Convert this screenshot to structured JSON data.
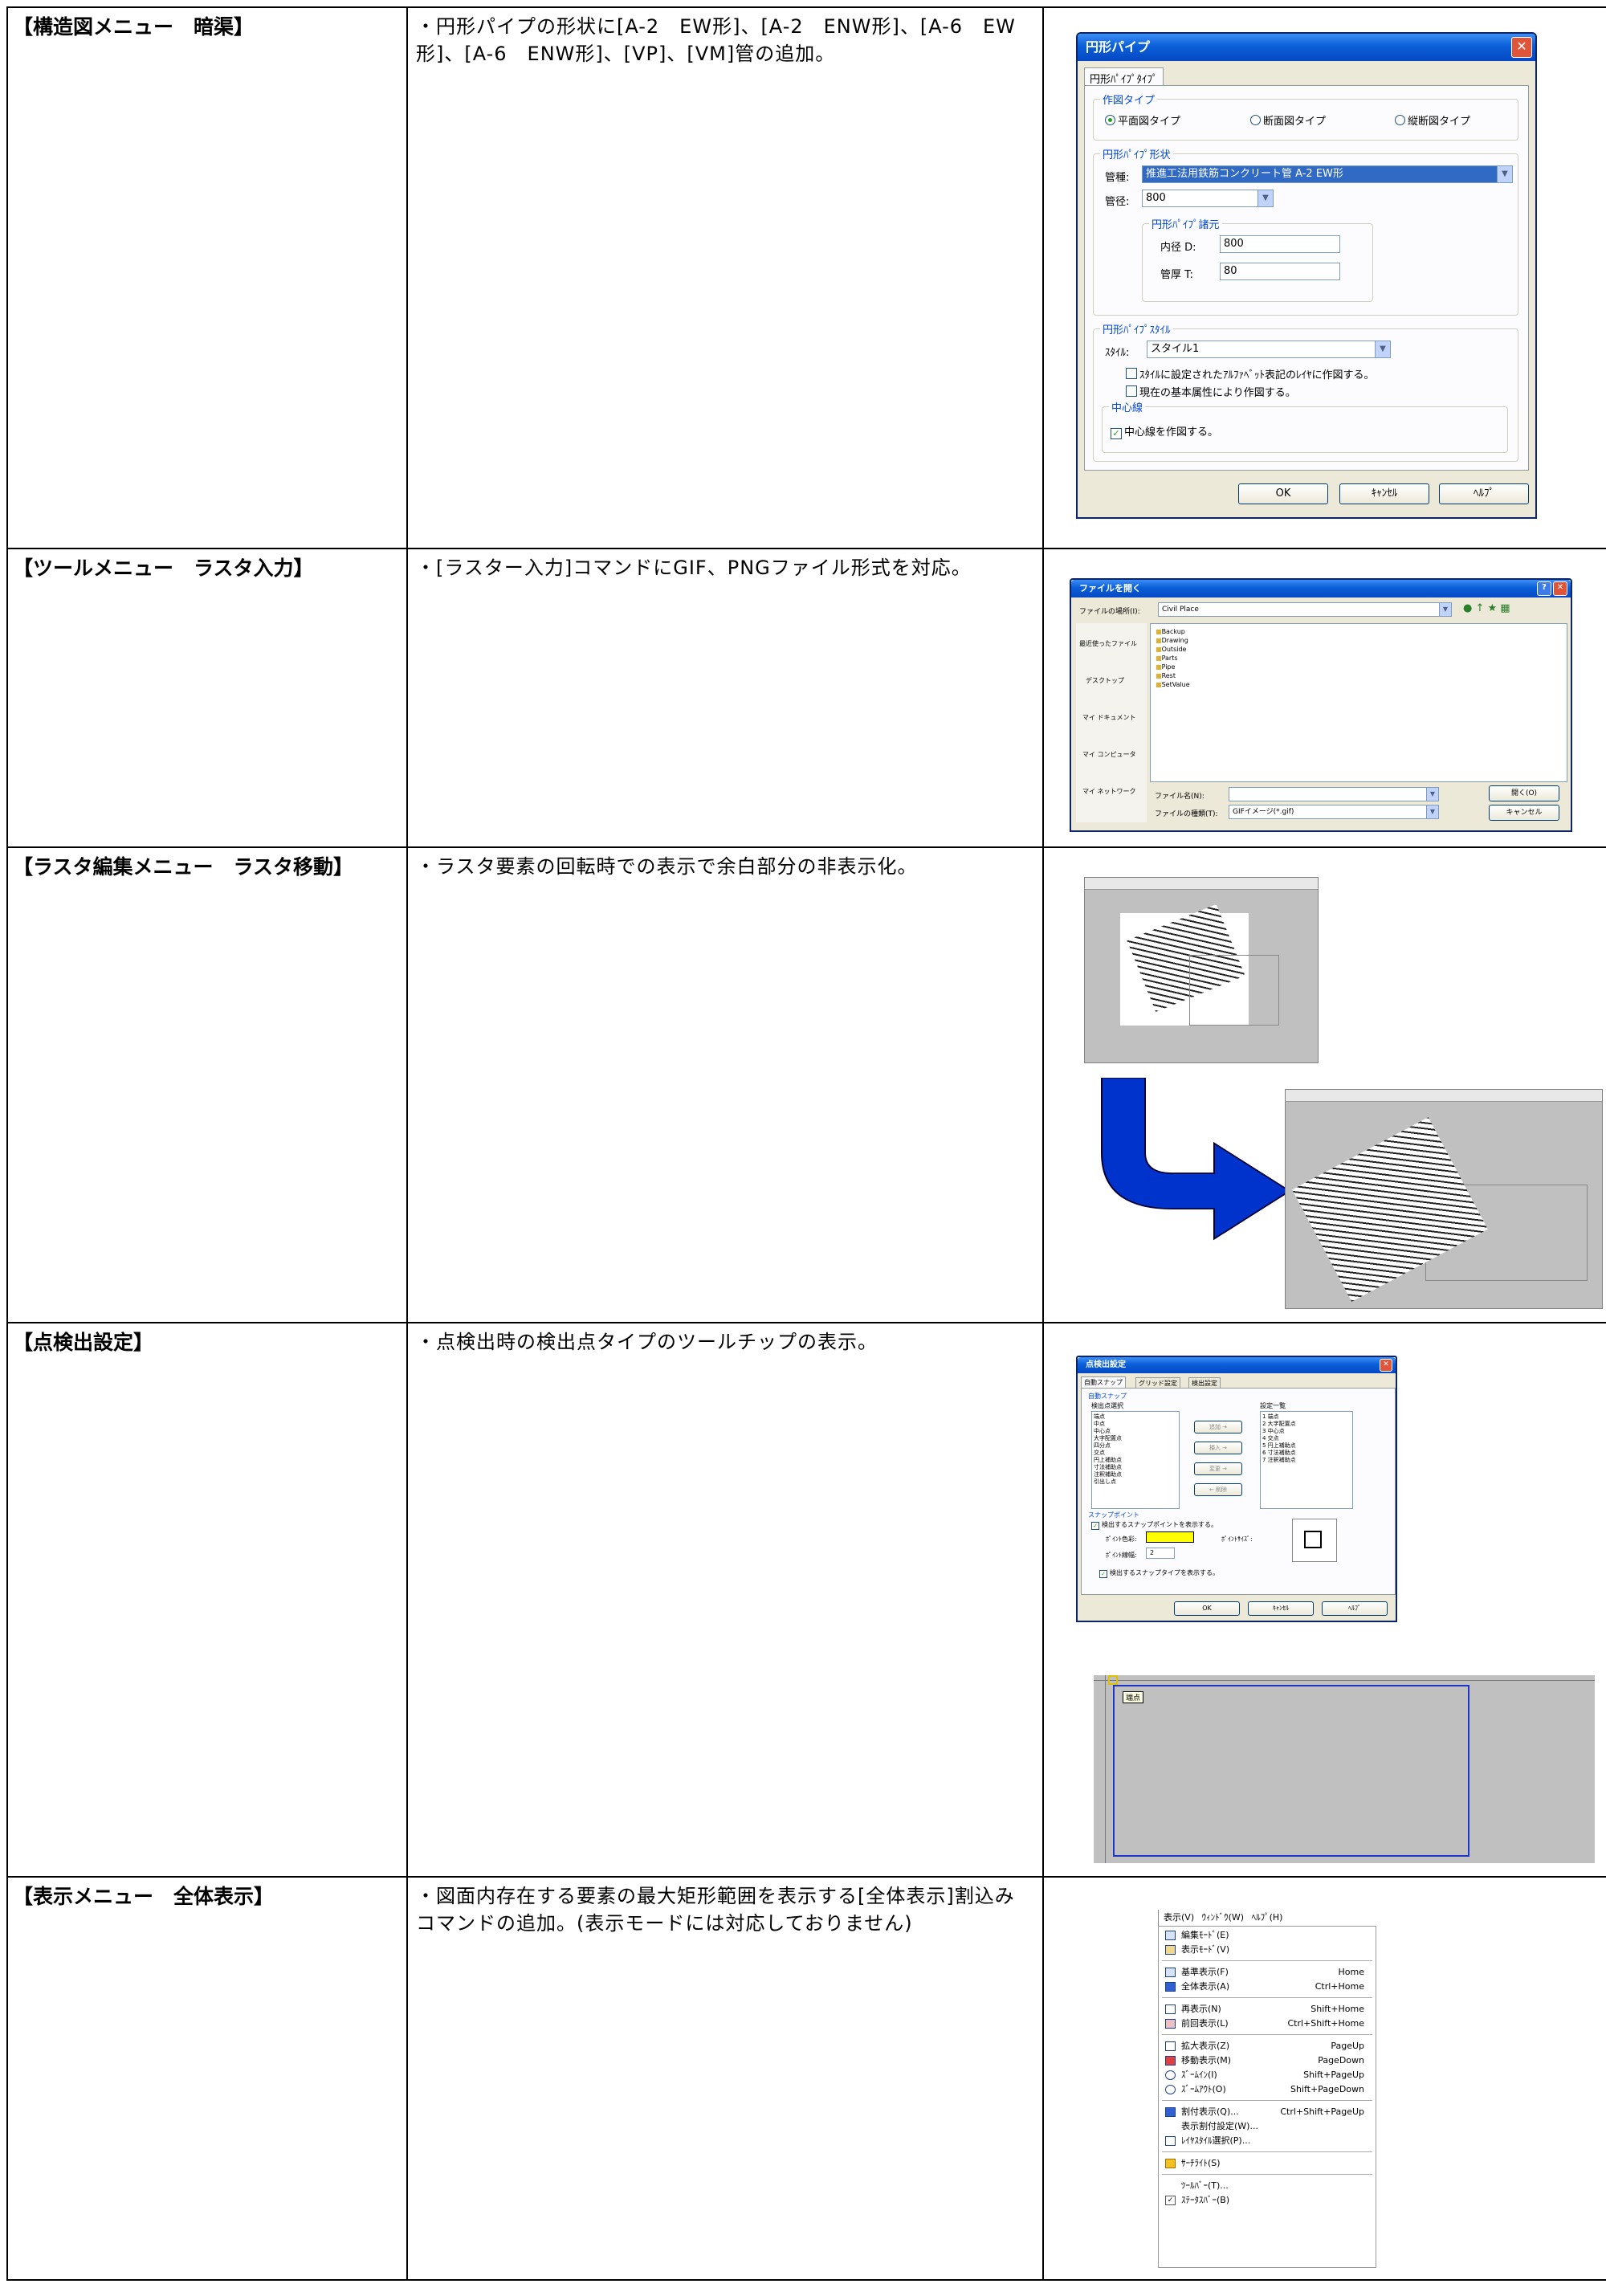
{
  "rows": [
    {
      "title": "【構造図メニュー　暗渠】",
      "desc": "・円形パイプの形状に[A-2　EW形]、[A-2　ENW形]、[A-6　EW形]、[A-6　ENW形]、[VP]、[VM]管の追加。"
    },
    {
      "title": "【ツールメニュー　ラスタ入力】",
      "desc": "・[ラスター入力]コマンドにGIF、PNGファイル形式を対応。"
    },
    {
      "title": "【ラスタ編集メニュー　ラスタ移動】",
      "desc": "・ラスタ要素の回転時での表示で余白部分の非表示化。"
    },
    {
      "title": "【点検出設定】",
      "desc": "・点検出時の検出点タイプのツールチップの表示。"
    },
    {
      "title": "【表示メニュー　全体表示】",
      "desc": "・図面内存在する要素の最大矩形範囲を表示する[全体表示]割込みコマンドの追加。(表示モードには対応しておりません)"
    }
  ],
  "pipe_dialog": {
    "title": "円形パイプ",
    "tab": "円形ﾊﾟｲﾌﾟﾀｲﾌﾟ",
    "draw_type_group": "作図タイプ",
    "draw_types": [
      "平面図タイプ",
      "断面図タイプ",
      "縦断図タイプ"
    ],
    "selected_draw_type": "平面図タイプ",
    "shape_group": "円形ﾊﾟｲﾌﾟ形状",
    "pipe_kind_label": "管種:",
    "pipe_kind_value": "推進工法用鉄筋コンクリート管 A-2 EW形",
    "diameter_label": "管径:",
    "diameter_value": "800",
    "dims_group": "円形ﾊﾟｲﾌﾟ諸元",
    "inner_d_label": "内径 D:",
    "inner_d_value": "800",
    "thickness_label": "管厚 T:",
    "thickness_value": "80",
    "style_group": "円形ﾊﾟｲﾌﾟｽﾀｲﾙ",
    "style_label": "ｽﾀｲﾙ:",
    "style_value": "スタイル1",
    "check_layer": "ｽﾀｲﾙに設定されたｱﾙﾌｧﾍﾞｯﾄ表記のﾚｲﾔに作図する。",
    "check_attr": "現在の基本属性により作図する。",
    "center_group": "中心線",
    "check_center": "中心線を作図する。",
    "ok": "OK",
    "cancel": "ｷｬﾝｾﾙ",
    "help": "ﾍﾙﾌﾟ"
  },
  "file_dialog": {
    "title": "ファイルを開く",
    "location_label": "ファイルの場所(I):",
    "location_value": "Civil Place",
    "folders": [
      "Backup",
      "Drawing",
      "Outside",
      "Parts",
      "Pipe",
      "Rest",
      "SetValue"
    ],
    "places": [
      "最近使ったファイル",
      "デスクトップ",
      "マイ ドキュメント",
      "マイ コンピュータ",
      "マイ ネットワーク"
    ],
    "filename_label": "ファイル名(N):",
    "filetype_label": "ファイルの種類(T):",
    "filetype_value": "GIFイメージ(*.gif)",
    "open": "開く(O)",
    "cancel": "キャンセル"
  },
  "snap_dialog": {
    "title": "点検出設定",
    "tabs": [
      "自動スナップ",
      "グリッド設定",
      "検出設定"
    ],
    "auto_snap": "自動スナップ",
    "detect_select": "検出点選択",
    "settings_list": "設定一覧",
    "detect_items": [
      "端点",
      "中点",
      "中心点",
      "大字配置点",
      "四分点",
      "交点",
      "円上補助点",
      "寸法補助点",
      "注釈補助点",
      "引出し点"
    ],
    "settings_items": [
      "1 端点",
      "2 大字配置点",
      "3 中心点",
      "4 交点",
      "5 円上補助点",
      "6 寸法補助点",
      "7 注釈補助点"
    ],
    "buttons": [
      "追加 →",
      "挿入 →",
      "変更 →",
      "← 削除"
    ],
    "snap_point": "スナップポイント",
    "show_snap": "検出するスナップポイントを表示する。",
    "color_label": "ﾎﾟｲﾝﾄ色彩:",
    "size_label": "ﾎﾟｲﾝﾄｻｲｽﾞ:",
    "width_label": "ﾎﾟｲﾝﾄ線幅:",
    "width_value": "2",
    "show_type": "検出するスナップタイプを表示する。",
    "ok": "OK",
    "cancel": "ｷｬﾝｾﾙ",
    "help": "ﾍﾙﾌﾟ",
    "tooltip": "端点"
  },
  "view_menu": {
    "menubar": [
      "表示(V)",
      "ｳｨﾝﾄﾞｳ(W)",
      "ﾍﾙﾌﾟ(H)"
    ],
    "groups": [
      [
        {
          "label": "編集ﾓｰﾄﾞ(E)",
          "shortcut": ""
        },
        {
          "label": "表示ﾓｰﾄﾞ(V)",
          "shortcut": ""
        }
      ],
      [
        {
          "label": "基準表示(F)",
          "shortcut": "Home"
        },
        {
          "label": "全体表示(A)",
          "shortcut": "Ctrl+Home"
        }
      ],
      [
        {
          "label": "再表示(N)",
          "shortcut": "Shift+Home"
        },
        {
          "label": "前回表示(L)",
          "shortcut": "Ctrl+Shift+Home"
        }
      ],
      [
        {
          "label": "拡大表示(Z)",
          "shortcut": "PageUp"
        },
        {
          "label": "移動表示(M)",
          "shortcut": "PageDown"
        },
        {
          "label": "ｽﾞｰﾑｲﾝ(I)",
          "shortcut": "Shift+PageUp"
        },
        {
          "label": "ｽﾞｰﾑｱｳﾄ(O)",
          "shortcut": "Shift+PageDown"
        }
      ],
      [
        {
          "label": "割付表示(Q)...",
          "shortcut": "Ctrl+Shift+PageUp"
        },
        {
          "label": "表示割付設定(W)...",
          "shortcut": ""
        },
        {
          "label": "ﾚｲﾔｽﾀｲﾙ選択(P)...",
          "shortcut": ""
        }
      ],
      [
        {
          "label": "ｻｰﾁﾗｲﾄ(S)",
          "shortcut": ""
        }
      ],
      [
        {
          "label": "ﾂｰﾙﾊﾞｰ(T)...",
          "shortcut": ""
        },
        {
          "label": "ｽﾃｰﾀｽﾊﾞｰ(B)",
          "shortcut": ""
        }
      ]
    ]
  },
  "colors": {
    "xp_title": "#0a5fd8",
    "arrow": "#0033cc",
    "canvas_gray": "#c0c0c0"
  }
}
